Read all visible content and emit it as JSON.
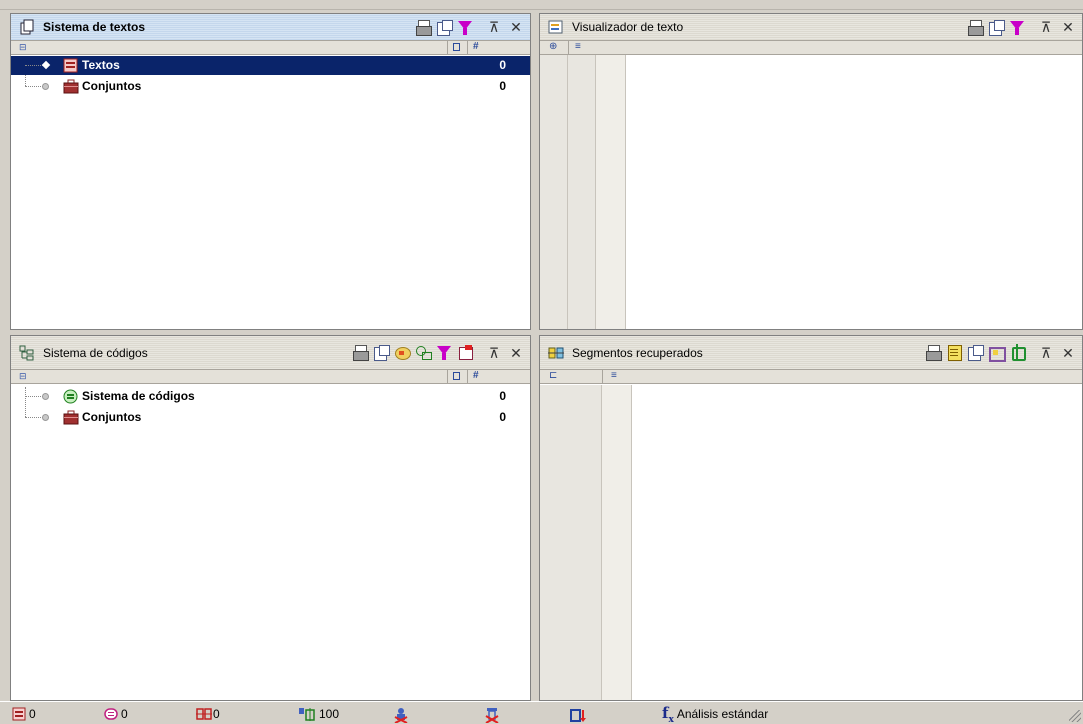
{
  "panes": {
    "texts": {
      "title": "Sistema de textos",
      "items": [
        {
          "label": "Textos",
          "count": "0"
        },
        {
          "label": "Conjuntos",
          "count": "0"
        }
      ]
    },
    "viewer": {
      "title": "Visualizador de texto"
    },
    "codes": {
      "title": "Sistema de códigos",
      "items": [
        {
          "label": "Sistema de códigos",
          "count": "0"
        },
        {
          "label": "Conjuntos",
          "count": "0"
        }
      ]
    },
    "segments": {
      "title": "Segmentos recuperados"
    }
  },
  "statusbar": {
    "texts_count": "0",
    "memos_count": "0",
    "codes_count": "0",
    "weight": "100",
    "analysis": "Análisis estándar",
    "fx": "f"
  },
  "colors": {
    "selection": "#0a246a",
    "active_title": "#c4d7ec",
    "panel_bg": "#d4d0c8"
  }
}
